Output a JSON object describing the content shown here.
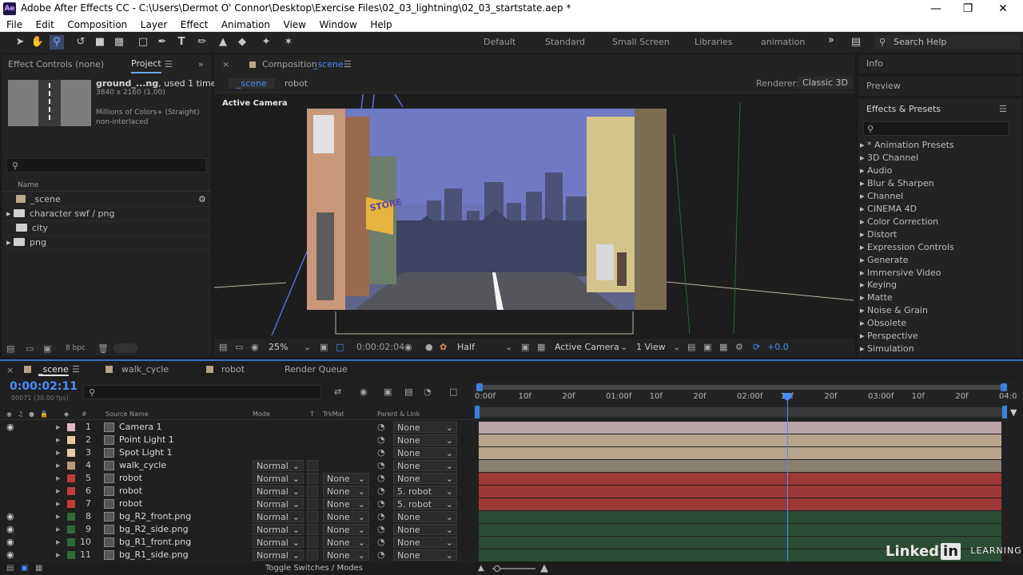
{
  "window": {
    "app_icon": "Ae",
    "title": "Adobe After Effects CC - C:\\Users\\Dermot O' Connor\\Desktop\\Exercise Files\\02_03_lightning\\02_03_startstate.aep *",
    "controls": [
      "minimize-icon",
      "maximize-icon",
      "close-icon"
    ]
  },
  "menu": [
    "File",
    "Edit",
    "Composition",
    "Layer",
    "Effect",
    "Animation",
    "View",
    "Window",
    "Help"
  ],
  "workspaces": [
    "Default",
    "Standard",
    "Small Screen",
    "Libraries",
    "animation"
  ],
  "workspaces_more": "»",
  "search_help": "Search Help",
  "project_panel": {
    "tab_effect_controls": "Effect Controls (none)",
    "tab_project": "Project",
    "footage_name": "ground_...ng",
    "footage_used": ", used 1 time",
    "footage_dims": "3840 x 2160 (1.00)",
    "footage_colors": "Millions of Colors+ (Straight)",
    "footage_interlace": "non-interlaced",
    "search_icon": "search-icon",
    "col_name": "Name",
    "items": [
      {
        "name": "_scene",
        "type": "comp"
      },
      {
        "name": "character swf / png",
        "type": "folder"
      },
      {
        "name": "city",
        "type": "folder"
      },
      {
        "name": "png",
        "type": "folder"
      }
    ],
    "bpc": "8 bpc"
  },
  "composition": {
    "panel_title": "Composition",
    "comp_name": "_scene",
    "breadcrumbs": [
      "_scene",
      "robot"
    ],
    "renderer_label": "Renderer:",
    "renderer_value": "Classic 3D",
    "view_label": "Active Camera",
    "zoom": "25%",
    "timecode": "0:00:02:04",
    "resolution": "Half",
    "camera": "Active Camera",
    "views": "1 View",
    "exposure": "+0.0",
    "store_sign": "STORE"
  },
  "right_panels": {
    "info": "Info",
    "preview": "Preview",
    "effects_title": "Effects & Presets",
    "effects": [
      "* Animation Presets",
      "3D Channel",
      "Audio",
      "Blur & Sharpen",
      "Channel",
      "CINEMA 4D",
      "Color Correction",
      "Distort",
      "Expression Controls",
      "Generate",
      "Immersive Video",
      "Keying",
      "Matte",
      "Noise & Grain",
      "Obsolete",
      "Perspective",
      "Simulation"
    ]
  },
  "timeline": {
    "tabs": [
      "_scene",
      "walk_cycle",
      "robot",
      "Render Queue"
    ],
    "tab_colors": [
      "#b6a287",
      "#b6a287",
      "#b6a287"
    ],
    "current_time": "0:00:02:11",
    "frame_info": "00071 (30.00 fps)",
    "headers": {
      "hash": "#",
      "source": "Source Name",
      "mode": "Mode",
      "t": "T",
      "trkmat": "TrkMat",
      "parent": "Parent & Link"
    },
    "ruler": [
      "0:00f",
      "10f",
      "20f",
      "01:00f",
      "10f",
      "20f",
      "02:00f",
      "10f",
      "20f",
      "03:00f",
      "10f",
      "20f",
      "04:0"
    ],
    "layers": [
      {
        "num": "1",
        "name": "Camera 1",
        "icon": "camera-icon",
        "color": "#e6b4c6",
        "mode": "",
        "trkmat": "",
        "parent": "None",
        "bar": "#b8a3a6",
        "eye": true
      },
      {
        "num": "2",
        "name": "Point Light 1",
        "icon": "light-icon",
        "color": "#e8c9a4",
        "mode": "",
        "trkmat": "",
        "parent": "None",
        "bar": "#b8a48b",
        "eye": false
      },
      {
        "num": "3",
        "name": "Spot Light 1",
        "icon": "light-icon",
        "color": "#e8c9a4",
        "mode": "",
        "trkmat": "",
        "parent": "None",
        "bar": "#b8a48b",
        "eye": false
      },
      {
        "num": "4",
        "name": "walk_cycle",
        "icon": "comp-icon",
        "color": "#b69b80",
        "mode": "Normal",
        "trkmat": "",
        "parent": "None",
        "bar": "#8b7f70",
        "eye": false
      },
      {
        "num": "5",
        "name": "robot",
        "icon": "comp-icon",
        "color": "#c23b3b",
        "mode": "Normal",
        "trkmat": "None",
        "parent": "None",
        "bar": "#9c3836",
        "eye": false
      },
      {
        "num": "6",
        "name": "robot",
        "icon": "comp-icon",
        "color": "#c23b3b",
        "mode": "Normal",
        "trkmat": "None",
        "parent": "5. robot",
        "bar": "#9c3836",
        "eye": false
      },
      {
        "num": "7",
        "name": "robot",
        "icon": "comp-icon",
        "color": "#c23b3b",
        "mode": "Normal",
        "trkmat": "None",
        "parent": "5. robot",
        "bar": "#9c3836",
        "eye": false
      },
      {
        "num": "8",
        "name": "bg_R2_front.png",
        "icon": "footage-icon",
        "color": "#2d6b3a",
        "mode": "Normal",
        "trkmat": "None",
        "parent": "None",
        "bar": "#2b4d34",
        "eye": true
      },
      {
        "num": "9",
        "name": "bg_R2_side.png",
        "icon": "footage-icon",
        "color": "#2d6b3a",
        "mode": "Normal",
        "trkmat": "None",
        "parent": "None",
        "bar": "#2b4d34",
        "eye": true
      },
      {
        "num": "10",
        "name": "bg_R1_front.png",
        "icon": "footage-icon",
        "color": "#2d6b3a",
        "mode": "Normal",
        "trkmat": "None",
        "parent": "None",
        "bar": "#2b4d34",
        "eye": true
      },
      {
        "num": "11",
        "name": "bg_R1_side.png",
        "icon": "footage-icon",
        "color": "#2d6b3a",
        "mode": "Normal",
        "trkmat": "None",
        "parent": "None",
        "bar": "#2b4d34",
        "eye": true
      }
    ],
    "toggle_label": "Toggle Switches / Modes"
  },
  "watermark": {
    "linked": "Linked",
    "in": "in",
    "learning": "LEARNING"
  }
}
